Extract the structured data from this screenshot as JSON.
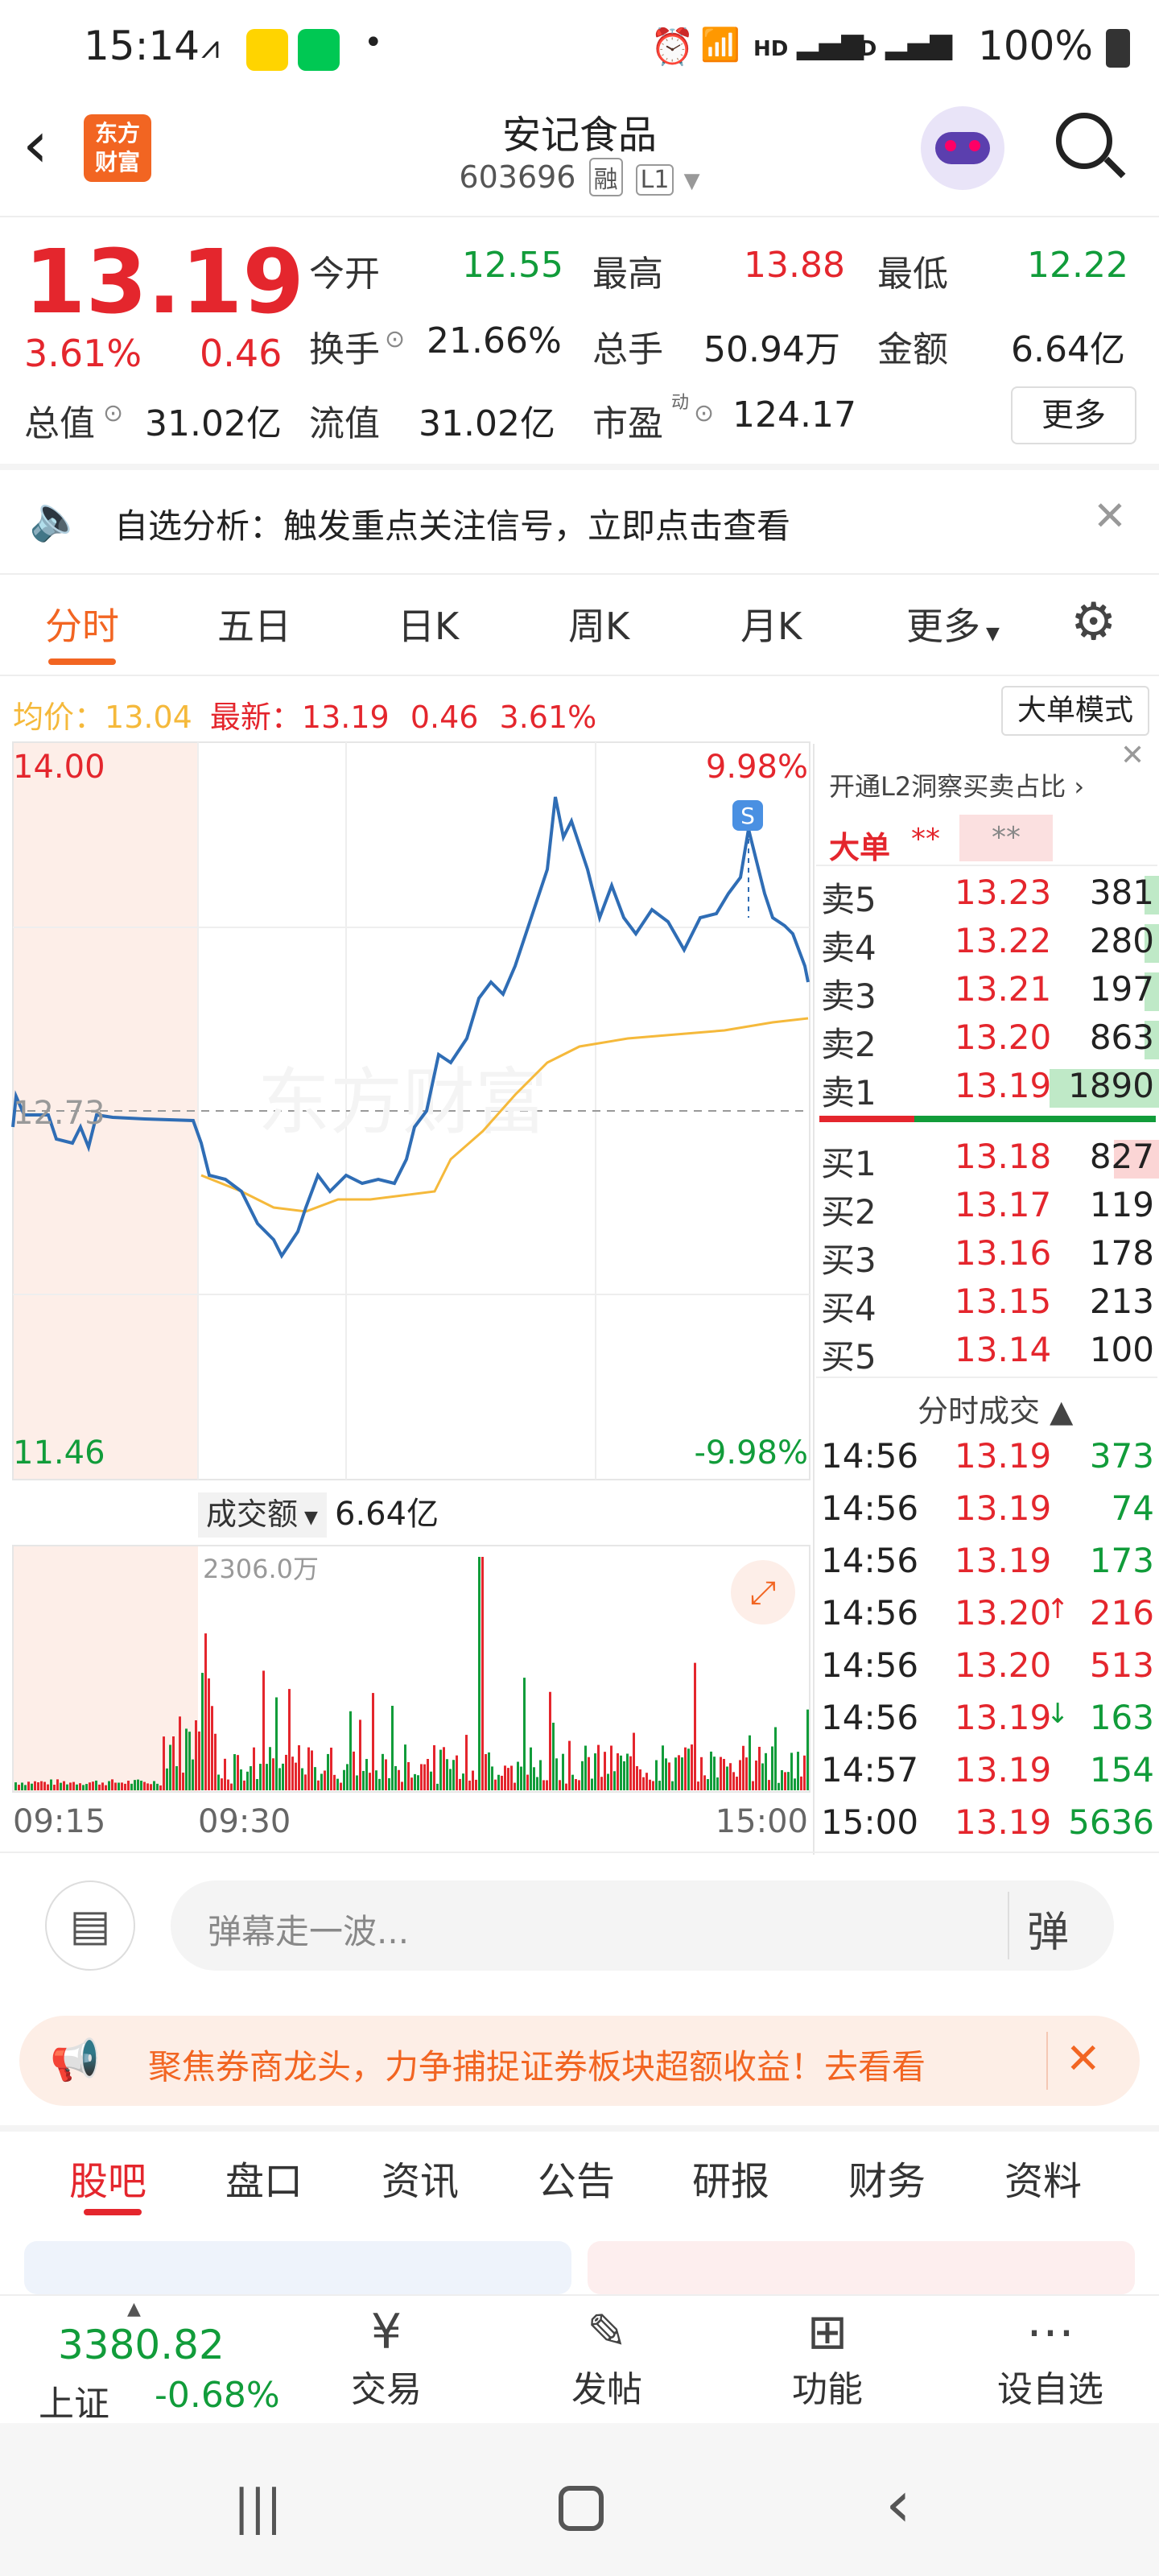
{
  "status_bar": {
    "time": "15:14",
    "hd1": "HD",
    "hd2": "HD",
    "battery": "100%"
  },
  "header": {
    "logo_line1": "东方",
    "logo_line2": "财富",
    "title": "安记食品",
    "code": "603696",
    "tag1": "融",
    "tag2": "L1"
  },
  "quote": {
    "price": "13.19",
    "change_pct": "3.61%",
    "change": "0.46",
    "open_label": "今开",
    "open": "12.55",
    "high_label": "最高",
    "high": "13.88",
    "low_label": "最低",
    "low": "12.22",
    "turnover_label": "换手",
    "turnover": "21.66%",
    "volume_label": "总手",
    "volume": "50.94万",
    "amount_label": "金额",
    "amount": "6.64亿",
    "mktcap_label": "总值",
    "mktcap": "31.02亿",
    "float_label": "流值",
    "float": "31.02亿",
    "pe_label": "市盈",
    "pe_sup": "动",
    "pe": "124.17",
    "more": "更多"
  },
  "banner": {
    "text": "自选分析：触发重点关注信号，立即点击查看"
  },
  "chart_tabs": [
    "分时",
    "五日",
    "日K",
    "周K",
    "月K",
    "更多"
  ],
  "info_line": {
    "avg_label": "均价：",
    "avg": "13.04",
    "latest_label": "最新：",
    "latest": "13.19",
    "chg": "0.46",
    "pct": "3.61%",
    "mode_btn": "大单模式"
  },
  "chart_labels": {
    "y_top": "14.00",
    "y_mid": "12.73",
    "y_bottom": "11.46",
    "pct_top": "9.98%",
    "pct_bottom": "-9.98%",
    "marker": "S",
    "watermark": "东方财富",
    "vol_selector": "成交额",
    "vol_total": "6.64亿",
    "vol_max": "2306.0万",
    "t_start": "09:15",
    "t_open": "09:30",
    "t_end": "15:00"
  },
  "order_book": {
    "l2_link": "开通L2洞察买卖占比",
    "big_label": "大单",
    "big_val1": "**",
    "big_val2": "**",
    "asks": [
      {
        "label": "卖5",
        "price": "13.23",
        "vol": "381"
      },
      {
        "label": "卖4",
        "price": "13.22",
        "vol": "280"
      },
      {
        "label": "卖3",
        "price": "13.21",
        "vol": "197"
      },
      {
        "label": "卖2",
        "price": "13.20",
        "vol": "863"
      },
      {
        "label": "卖1",
        "price": "13.19",
        "vol": "1890"
      }
    ],
    "bids": [
      {
        "label": "买1",
        "price": "13.18",
        "vol": "827"
      },
      {
        "label": "买2",
        "price": "13.17",
        "vol": "119"
      },
      {
        "label": "买3",
        "price": "13.16",
        "vol": "178"
      },
      {
        "label": "买4",
        "price": "13.15",
        "vol": "213"
      },
      {
        "label": "买5",
        "price": "13.14",
        "vol": "100"
      }
    ],
    "trades_title": "分时成交",
    "trades": [
      {
        "time": "14:56",
        "price": "13.19",
        "vol": "373",
        "arrow": ""
      },
      {
        "time": "14:56",
        "price": "13.19",
        "vol": "74",
        "arrow": ""
      },
      {
        "time": "14:56",
        "price": "13.19",
        "vol": "173",
        "arrow": ""
      },
      {
        "time": "14:56",
        "price": "13.20",
        "vol": "216",
        "arrow": "↑"
      },
      {
        "time": "14:56",
        "price": "13.20",
        "vol": "513",
        "arrow": ""
      },
      {
        "time": "14:56",
        "price": "13.19",
        "vol": "163",
        "arrow": "↓"
      },
      {
        "time": "14:57",
        "price": "13.19",
        "vol": "154",
        "arrow": ""
      },
      {
        "time": "15:00",
        "price": "13.19",
        "vol": "5636",
        "arrow": ""
      }
    ]
  },
  "danmu": {
    "placeholder": "弹幕走一波...",
    "btn": "弹"
  },
  "ad": {
    "text": "聚焦券商龙头，力争捕捉证券板块超额收益！去看看"
  },
  "bottom_tabs": [
    "股吧",
    "盘口",
    "资讯",
    "公告",
    "研报",
    "财务",
    "资料"
  ],
  "index": {
    "value": "3380.82",
    "name": "上证",
    "chg": "-0.68%"
  },
  "nav": [
    "交易",
    "发帖",
    "功能",
    "设自选"
  ],
  "colors": {
    "red": "#e4262d",
    "green": "#119c3a",
    "orange": "#f26522",
    "line": "#2f6db5",
    "avg": "#f5b93b"
  }
}
